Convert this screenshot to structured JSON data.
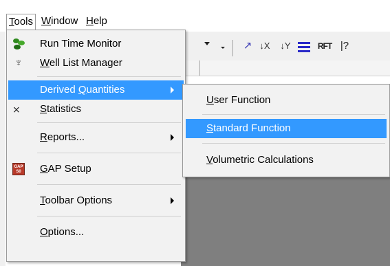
{
  "menubar": {
    "items": [
      {
        "pre": "",
        "key": "T",
        "post": "ools"
      },
      {
        "pre": "",
        "key": "W",
        "post": "indow"
      },
      {
        "pre": "",
        "key": "H",
        "post": "elp"
      }
    ]
  },
  "toolbar": {
    "icons": [
      "dropdown-arrow-icon",
      "add-x-axis-icon",
      "remove-x-icon",
      "remove-y-icon",
      "lines-icon",
      "rft-icon",
      "help-cursor-icon"
    ],
    "rft_text": "RFT",
    "help_text": "|?"
  },
  "tools_menu": {
    "items": [
      {
        "pre": "",
        "key": "",
        "post": "Run Time Monitor",
        "icon": "run-time-monitor-icon"
      },
      {
        "pre": "",
        "key": "W",
        "post": "ell List Manager",
        "icon": "well-list-icon"
      },
      {
        "pre": "Derived ",
        "key": "Q",
        "post": "uantities",
        "submenu": true,
        "highlighted": true
      },
      {
        "pre": "",
        "key": "S",
        "post": "tatistics",
        "icon": "statistics-icon"
      },
      {
        "pre": "",
        "key": "R",
        "post": "eports...",
        "submenu": true
      },
      {
        "pre": "",
        "key": "G",
        "post": "AP Setup",
        "icon": "gap-icon"
      },
      {
        "pre": "",
        "key": "T",
        "post": "oolbar Options",
        "submenu": true
      },
      {
        "pre": "",
        "key": "O",
        "post": "ptions..."
      }
    ],
    "gap_icon_text_top": "GAP",
    "gap_icon_text_bottom": "S0"
  },
  "derived_submenu": {
    "items": [
      {
        "pre": "",
        "key": "U",
        "post": "ser Function"
      },
      {
        "pre": "",
        "key": "S",
        "post": "tandard Function",
        "highlighted": true
      },
      {
        "pre": "",
        "key": "V",
        "post": "olumetric Calculations"
      }
    ]
  },
  "colors": {
    "highlight": "#3399ff",
    "menu_bg": "#f2f2f2",
    "workspace_gray": "#7f7f7f"
  }
}
